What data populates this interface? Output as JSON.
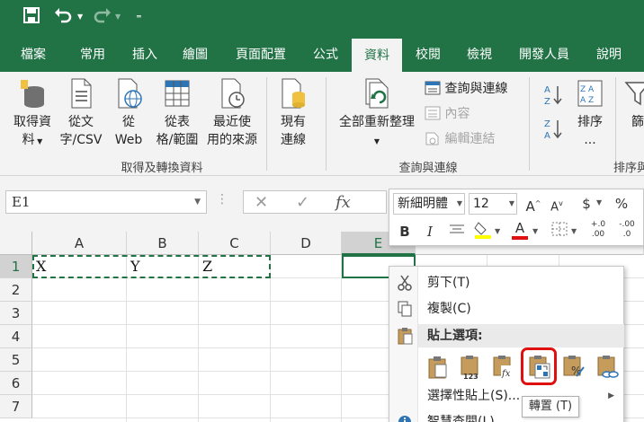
{
  "quick_access": {
    "save_icon": "save-icon",
    "undo_icon": "undo-icon",
    "redo_icon": "redo-icon",
    "customize_icon": "customize-qat-icon"
  },
  "tabs": [
    {
      "label": "檔案"
    },
    {
      "label": "常用"
    },
    {
      "label": "插入"
    },
    {
      "label": "繪圖"
    },
    {
      "label": "頁面配置"
    },
    {
      "label": "公式"
    },
    {
      "label": "資料",
      "active": true
    },
    {
      "label": "校閱"
    },
    {
      "label": "檢視"
    },
    {
      "label": "開發人員"
    },
    {
      "label": "說明"
    }
  ],
  "ribbon": {
    "get_data": {
      "line1": "取得資",
      "line2": "料"
    },
    "from_csv": {
      "line1": "從文",
      "line2": "字/CSV"
    },
    "from_web": {
      "line1": "從",
      "line2": "Web"
    },
    "from_table": {
      "line1": "從表",
      "line2": "格/範圍"
    },
    "recent_sources": {
      "line1": "最近使",
      "line2": "用的來源"
    },
    "existing_conn": {
      "line1": "現有",
      "line2": "連線"
    },
    "group_get_transform": "取得及轉換資料",
    "refresh_all": "全部重新整理",
    "queries_connections": "查詢與連線",
    "properties": "內容",
    "edit_links": "編輯連結",
    "group_queries": "查詢與連線",
    "sort": {
      "line1": "排序",
      "line2": "..."
    },
    "filter_partial": "篩",
    "group_sort_partial": "排序與"
  },
  "formula_bar": {
    "name_box": "E1",
    "cancel_glyph": "✕",
    "enter_glyph": "✓",
    "fx_glyph": "fx"
  },
  "grid": {
    "columns": [
      "A",
      "B",
      "C",
      "D",
      "E"
    ],
    "rows": [
      "1",
      "2",
      "3",
      "4",
      "5",
      "6",
      "7"
    ],
    "cells": {
      "A1": "X",
      "B1": "Y",
      "C1": "Z"
    },
    "active_cell": "E1"
  },
  "mini_toolbar": {
    "font_name": "新細明體",
    "font_size": "12",
    "grow_font": "A",
    "shrink_font": "A",
    "currency": "$",
    "percent": "%",
    "bold": "B",
    "italic": "I",
    "font_color_letter": "A",
    "decimal_inc": "+.0 .00",
    "decimal_dec": "-.00 .0"
  },
  "context_menu": {
    "cut": "剪下(T)",
    "copy": "複製(C)",
    "paste_options_header": "貼上選項:",
    "paste_special": "選擇性貼上(S)...",
    "insert_comment_partial": "智慧查閱(L)"
  },
  "tooltip": "轉置 (T)",
  "colors": {
    "excel_green": "#217346",
    "highlight_red": "#e01010"
  }
}
